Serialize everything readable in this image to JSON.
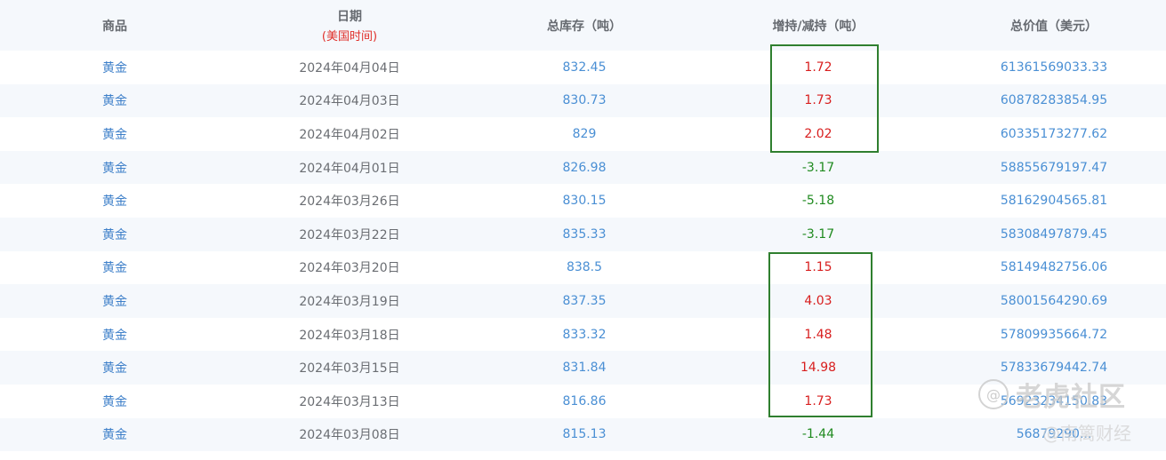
{
  "headers": {
    "product": "商品",
    "date": "日期",
    "date_sub": "(美国时间)",
    "stock": "总库存（吨）",
    "change": "增持/减持（吨）",
    "value": "总价值（美元）"
  },
  "rows": [
    {
      "product": "黄金",
      "date": "2024年04月04日",
      "stock": "832.45",
      "change": "1.72",
      "value": "61361569033.33"
    },
    {
      "product": "黄金",
      "date": "2024年04月03日",
      "stock": "830.73",
      "change": "1.73",
      "value": "60878283854.95"
    },
    {
      "product": "黄金",
      "date": "2024年04月02日",
      "stock": "829",
      "change": "2.02",
      "value": "60335173277.62"
    },
    {
      "product": "黄金",
      "date": "2024年04月01日",
      "stock": "826.98",
      "change": "-3.17",
      "value": "58855679197.47"
    },
    {
      "product": "黄金",
      "date": "2024年03月26日",
      "stock": "830.15",
      "change": "-5.18",
      "value": "58162904565.81"
    },
    {
      "product": "黄金",
      "date": "2024年03月22日",
      "stock": "835.33",
      "change": "-3.17",
      "value": "58308497879.45"
    },
    {
      "product": "黄金",
      "date": "2024年03月20日",
      "stock": "838.5",
      "change": "1.15",
      "value": "58149482756.06"
    },
    {
      "product": "黄金",
      "date": "2024年03月19日",
      "stock": "837.35",
      "change": "4.03",
      "value": "58001564290.69"
    },
    {
      "product": "黄金",
      "date": "2024年03月18日",
      "stock": "833.32",
      "change": "1.48",
      "value": "57809935664.72"
    },
    {
      "product": "黄金",
      "date": "2024年03月15日",
      "stock": "831.84",
      "change": "14.98",
      "value": "57833679442.74"
    },
    {
      "product": "黄金",
      "date": "2024年03月13日",
      "stock": "816.86",
      "change": "1.73",
      "value": "56923234150.83"
    },
    {
      "product": "黄金",
      "date": "2024年03月08日",
      "stock": "815.13",
      "change": "-1.44",
      "value": "56879290..."
    }
  ],
  "colors": {
    "positive": "#d81e1e",
    "negative": "#1f8a1f",
    "highlight_box": "#2f7f2f",
    "link_blue": "#4a8fd4"
  },
  "watermark": {
    "logo_glyph": "@",
    "line1": "老虎社区",
    "line2": "@南篱财经"
  }
}
